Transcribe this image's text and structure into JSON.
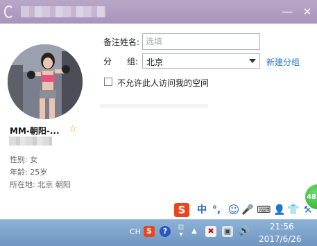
{
  "window": {
    "minimize_glyph": "—",
    "close_glyph": "✕"
  },
  "profile": {
    "nickname": "MM-朝阳-...",
    "gender": "性别: 女",
    "age": "年龄: 25岁",
    "location": "所在地: 北京  朝阳"
  },
  "form": {
    "remark_label": "备注姓名:",
    "remark_placeholder": "选填",
    "group_label_left": "分",
    "group_label_right": "组:",
    "group_value": "北京",
    "new_group_link": "新建分组",
    "checkbox_label": "不允许此人访问我的空间"
  },
  "ime_bar": {
    "logo": "S",
    "mode": "中",
    "punct": "°,",
    "emoji": "☺",
    "mic": "🎤",
    "keyboard": "⌨",
    "user": "👤",
    "shirt": "👕",
    "tool": "⚒"
  },
  "badge_number": "48",
  "taskbar": {
    "lang": "CH",
    "time": "21:56",
    "date": "2017/6/26"
  },
  "colors": {
    "titlebar": "#b09bc1",
    "link": "#2a7ac7",
    "star": "#e6b21b",
    "taskbar": "#7ea4cc"
  }
}
